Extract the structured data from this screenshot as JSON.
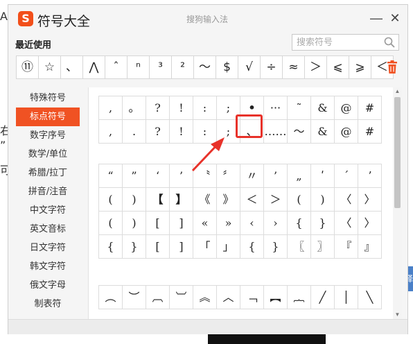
{
  "window": {
    "title": "符号大全",
    "subtitle": "搜狗输入法",
    "logo_letter": "S",
    "minimize_glyph": "—",
    "close_glyph": "✕"
  },
  "background": {
    "frag1": "A",
    "frag2": "右",
    "frag3": "”",
    "frag4": "可",
    "side_tab": "择"
  },
  "recent": {
    "label": "最近使用",
    "symbols": [
      "⑪",
      "☆",
      "、",
      "⋀",
      "ˆ",
      "ⁿ",
      "³",
      "²",
      "～",
      "$",
      "√",
      "÷",
      "≈",
      "＞",
      "⩽",
      "⩾",
      "＜"
    ]
  },
  "search": {
    "placeholder": "搜索符号"
  },
  "sidebar": {
    "items": [
      {
        "label": "特殊符号",
        "active": false
      },
      {
        "label": "标点符号",
        "active": true
      },
      {
        "label": "数字序号",
        "active": false
      },
      {
        "label": "数学/单位",
        "active": false
      },
      {
        "label": "希腊/拉丁",
        "active": false
      },
      {
        "label": "拼音/注音",
        "active": false
      },
      {
        "label": "中文字符",
        "active": false
      },
      {
        "label": "英文音标",
        "active": false
      },
      {
        "label": "日文字符",
        "active": false
      },
      {
        "label": "韩文字符",
        "active": false
      },
      {
        "label": "俄文字母",
        "active": false
      },
      {
        "label": "制表符",
        "active": false
      }
    ]
  },
  "grids": [
    {
      "rows": [
        [
          ",",
          "。",
          "?",
          "!",
          ":",
          ";",
          "•",
          "···",
          "˜",
          "&",
          "@",
          "#"
        ],
        [
          ",",
          ".",
          "?",
          "!",
          ":",
          ";",
          "、",
          "……",
          "～",
          "&",
          "@",
          "#"
        ]
      ]
    },
    {
      "rows": [
        [
          "“",
          "”",
          "‘",
          "’",
          "〝",
          "〞",
          "〃",
          "’",
          "„",
          "ʹ",
          "ˊ",
          "ʼ"
        ],
        [
          "(",
          ")",
          "【",
          "】",
          "《",
          "》",
          "＜",
          "＞",
          "(",
          ")",
          "〈",
          "〉"
        ],
        [
          "(",
          ")",
          "[",
          "]",
          "«",
          "»",
          "‹",
          "›",
          "{",
          "}",
          "〈",
          "〉"
        ],
        [
          "{",
          "}",
          "[",
          "]",
          "「",
          "」",
          "{",
          "}",
          "〖",
          "〗",
          "『",
          "』"
        ]
      ]
    },
    {
      "rows": [
        [
          "︵",
          "︶",
          "︹",
          "︺",
          "︽",
          "︿",
          "﹁",
          "︻",
          "︷",
          "╱",
          "│",
          "╲"
        ]
      ]
    }
  ],
  "highlighted_symbol": "、",
  "accent_color": "#f05223",
  "highlight_color": "#e8322a"
}
